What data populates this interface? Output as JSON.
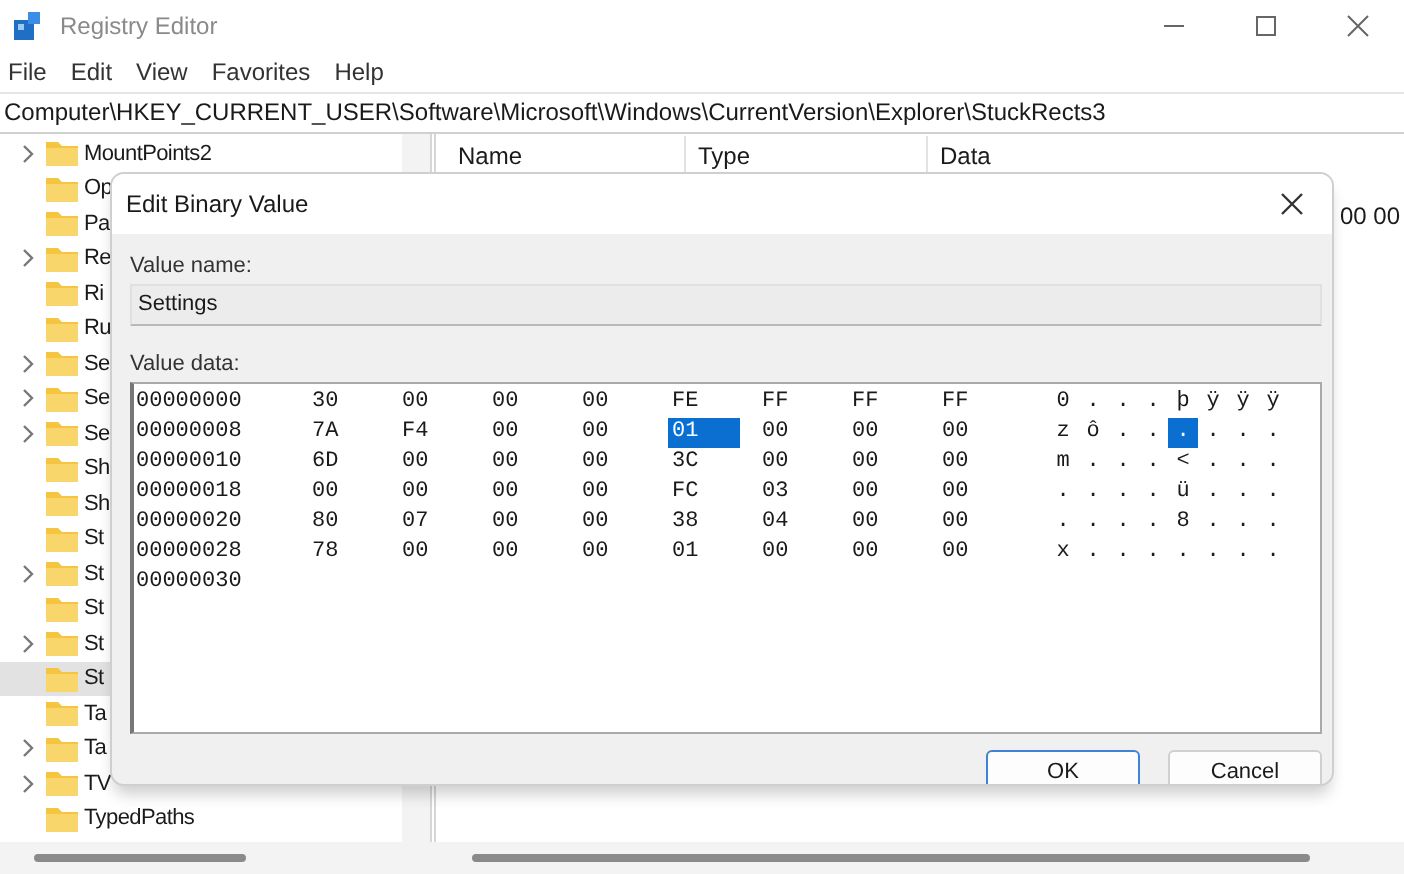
{
  "window": {
    "title": "Registry Editor"
  },
  "menu": [
    "File",
    "Edit",
    "View",
    "Favorites",
    "Help"
  ],
  "address": "Computer\\HKEY_CURRENT_USER\\Software\\Microsoft\\Windows\\CurrentVersion\\Explorer\\StuckRects3",
  "tree": [
    {
      "label": "MountPoints2",
      "expandable": true,
      "selected": false
    },
    {
      "label": "Op",
      "expandable": false,
      "selected": false
    },
    {
      "label": "Pa",
      "expandable": false,
      "selected": false
    },
    {
      "label": "Re",
      "expandable": true,
      "selected": false
    },
    {
      "label": "Ri",
      "expandable": false,
      "selected": false
    },
    {
      "label": "Ru",
      "expandable": false,
      "selected": false
    },
    {
      "label": "Se",
      "expandable": true,
      "selected": false
    },
    {
      "label": "Se",
      "expandable": true,
      "selected": false
    },
    {
      "label": "Se",
      "expandable": true,
      "selected": false
    },
    {
      "label": "Sh",
      "expandable": false,
      "selected": false
    },
    {
      "label": "Sh",
      "expandable": false,
      "selected": false
    },
    {
      "label": "St",
      "expandable": false,
      "selected": false
    },
    {
      "label": "St",
      "expandable": true,
      "selected": false
    },
    {
      "label": "St",
      "expandable": false,
      "selected": false
    },
    {
      "label": "St",
      "expandable": true,
      "selected": false
    },
    {
      "label": "St",
      "expandable": false,
      "selected": true
    },
    {
      "label": "Ta",
      "expandable": false,
      "selected": false
    },
    {
      "label": "Ta",
      "expandable": true,
      "selected": false
    },
    {
      "label": "TV",
      "expandable": true,
      "selected": false
    },
    {
      "label": "TypedPaths",
      "expandable": false,
      "selected": false
    }
  ],
  "list": {
    "columns": [
      "Name",
      "Type",
      "Data"
    ],
    "visible_data": "00 00"
  },
  "dialog": {
    "title": "Edit Binary Value",
    "name_label": "Value name:",
    "name_value": "Settings",
    "data_label": "Value data:",
    "rows": [
      {
        "address": "00000000",
        "bytes": [
          {
            "text": "30",
            "selected": false
          },
          {
            "text": "00",
            "selected": false
          },
          {
            "text": "00",
            "selected": false
          },
          {
            "text": "00",
            "selected": false
          },
          {
            "text": "FE",
            "selected": false
          },
          {
            "text": "FF",
            "selected": false
          },
          {
            "text": "FF",
            "selected": false
          },
          {
            "text": "FF",
            "selected": false
          }
        ],
        "ascii": [
          {
            "text": "0",
            "selected": false
          },
          {
            "text": ".",
            "selected": false
          },
          {
            "text": ".",
            "selected": false
          },
          {
            "text": ".",
            "selected": false
          },
          {
            "text": "þ",
            "selected": false
          },
          {
            "text": "ÿ",
            "selected": false
          },
          {
            "text": "ÿ",
            "selected": false
          },
          {
            "text": "ÿ",
            "selected": false
          }
        ]
      },
      {
        "address": "00000008",
        "bytes": [
          {
            "text": "7A",
            "selected": false
          },
          {
            "text": "F4",
            "selected": false
          },
          {
            "text": "00",
            "selected": false
          },
          {
            "text": "00",
            "selected": false
          },
          {
            "text": "01",
            "selected": true
          },
          {
            "text": "00",
            "selected": false
          },
          {
            "text": "00",
            "selected": false
          },
          {
            "text": "00",
            "selected": false
          }
        ],
        "ascii": [
          {
            "text": "z",
            "selected": false
          },
          {
            "text": "ô",
            "selected": false
          },
          {
            "text": ".",
            "selected": false
          },
          {
            "text": ".",
            "selected": false
          },
          {
            "text": ".",
            "selected": true
          },
          {
            "text": ".",
            "selected": false
          },
          {
            "text": ".",
            "selected": false
          },
          {
            "text": ".",
            "selected": false
          }
        ]
      },
      {
        "address": "00000010",
        "bytes": [
          {
            "text": "6D",
            "selected": false
          },
          {
            "text": "00",
            "selected": false
          },
          {
            "text": "00",
            "selected": false
          },
          {
            "text": "00",
            "selected": false
          },
          {
            "text": "3C",
            "selected": false
          },
          {
            "text": "00",
            "selected": false
          },
          {
            "text": "00",
            "selected": false
          },
          {
            "text": "00",
            "selected": false
          }
        ],
        "ascii": [
          {
            "text": "m",
            "selected": false
          },
          {
            "text": ".",
            "selected": false
          },
          {
            "text": ".",
            "selected": false
          },
          {
            "text": ".",
            "selected": false
          },
          {
            "text": "<",
            "selected": false
          },
          {
            "text": ".",
            "selected": false
          },
          {
            "text": ".",
            "selected": false
          },
          {
            "text": ".",
            "selected": false
          }
        ]
      },
      {
        "address": "00000018",
        "bytes": [
          {
            "text": "00",
            "selected": false
          },
          {
            "text": "00",
            "selected": false
          },
          {
            "text": "00",
            "selected": false
          },
          {
            "text": "00",
            "selected": false
          },
          {
            "text": "FC",
            "selected": false
          },
          {
            "text": "03",
            "selected": false
          },
          {
            "text": "00",
            "selected": false
          },
          {
            "text": "00",
            "selected": false
          }
        ],
        "ascii": [
          {
            "text": ".",
            "selected": false
          },
          {
            "text": ".",
            "selected": false
          },
          {
            "text": ".",
            "selected": false
          },
          {
            "text": ".",
            "selected": false
          },
          {
            "text": "ü",
            "selected": false
          },
          {
            "text": ".",
            "selected": false
          },
          {
            "text": ".",
            "selected": false
          },
          {
            "text": ".",
            "selected": false
          }
        ]
      },
      {
        "address": "00000020",
        "bytes": [
          {
            "text": "80",
            "selected": false
          },
          {
            "text": "07",
            "selected": false
          },
          {
            "text": "00",
            "selected": false
          },
          {
            "text": "00",
            "selected": false
          },
          {
            "text": "38",
            "selected": false
          },
          {
            "text": "04",
            "selected": false
          },
          {
            "text": "00",
            "selected": false
          },
          {
            "text": "00",
            "selected": false
          }
        ],
        "ascii": [
          {
            "text": ".",
            "selected": false
          },
          {
            "text": ".",
            "selected": false
          },
          {
            "text": ".",
            "selected": false
          },
          {
            "text": ".",
            "selected": false
          },
          {
            "text": "8",
            "selected": false
          },
          {
            "text": ".",
            "selected": false
          },
          {
            "text": ".",
            "selected": false
          },
          {
            "text": ".",
            "selected": false
          }
        ]
      },
      {
        "address": "00000028",
        "bytes": [
          {
            "text": "78",
            "selected": false
          },
          {
            "text": "00",
            "selected": false
          },
          {
            "text": "00",
            "selected": false
          },
          {
            "text": "00",
            "selected": false
          },
          {
            "text": "01",
            "selected": false
          },
          {
            "text": "00",
            "selected": false
          },
          {
            "text": "00",
            "selected": false
          },
          {
            "text": "00",
            "selected": false
          }
        ],
        "ascii": [
          {
            "text": "x",
            "selected": false
          },
          {
            "text": ".",
            "selected": false
          },
          {
            "text": ".",
            "selected": false
          },
          {
            "text": ".",
            "selected": false
          },
          {
            "text": ".",
            "selected": false
          },
          {
            "text": ".",
            "selected": false
          },
          {
            "text": ".",
            "selected": false
          },
          {
            "text": ".",
            "selected": false
          }
        ]
      },
      {
        "address": "00000030"
      }
    ],
    "buttons": [
      {
        "label": "OK",
        "default": true
      },
      {
        "label": "Cancel",
        "default": false
      }
    ]
  }
}
